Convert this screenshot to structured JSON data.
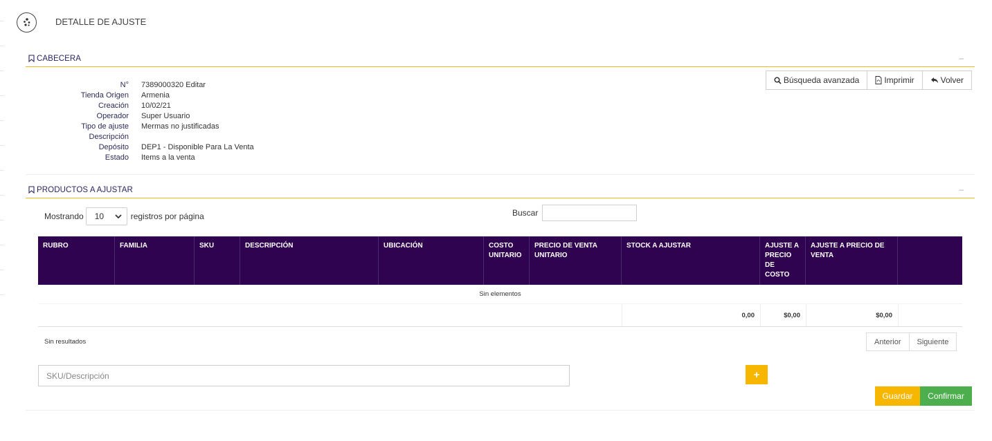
{
  "page_title": "DETALLE DE AJUSTE",
  "cabecera": {
    "title": "CABECERA",
    "collapse": "–",
    "fields": [
      {
        "label": "N°",
        "value": "7389000320 Editar"
      },
      {
        "label": "Tienda Origen",
        "value": "Armenia"
      },
      {
        "label": "Creación",
        "value": "10/02/21"
      },
      {
        "label": "Operador",
        "value": "Super Usuario"
      },
      {
        "label": "Tipo de ajuste",
        "value": "Mermas no justificadas"
      },
      {
        "label": "Descripción",
        "value": ""
      },
      {
        "label": "Depósito",
        "value": "DEP1 - Disponible Para La Venta"
      },
      {
        "label": "Estado",
        "value": "Items a la venta"
      }
    ],
    "buttons": {
      "busqueda": "Búsqueda avanzada",
      "imprimir": "Imprimir",
      "volver": "Volver"
    }
  },
  "productos": {
    "title": "PRODUCTOS A AJUSTAR",
    "collapse": "–",
    "length": {
      "prefix": "Mostrando",
      "selected": "10",
      "suffix": "registros por página"
    },
    "search_label": "Buscar",
    "columns": [
      "RUBRO",
      "FAMILIA",
      "SKU",
      "DESCRIPCIÓN",
      "UBICACIÓN",
      "COSTO UNITARIO",
      "PRECIO DE VENTA UNITARIO",
      "STOCK A AJUSTAR",
      "AJUSTE A PRECIO DE COSTO",
      "AJUSTE A PRECIO DE VENTA",
      ""
    ],
    "empty_message": "Sin elementos",
    "totals": {
      "stock": "0,00",
      "costo": "$0,00",
      "venta": "$0,00"
    },
    "info": "Sin resultados",
    "pager": {
      "prev": "Anterior",
      "next": "Siguiente"
    },
    "sku_placeholder": "SKU/Descripción",
    "add_label": "+",
    "guardar": "Guardar",
    "confirmar": "Confirmar"
  },
  "colors": {
    "header_bg": "#300350",
    "accent": "#f7b600",
    "success": "#4cae4c",
    "section_line": "#f0b81c"
  }
}
